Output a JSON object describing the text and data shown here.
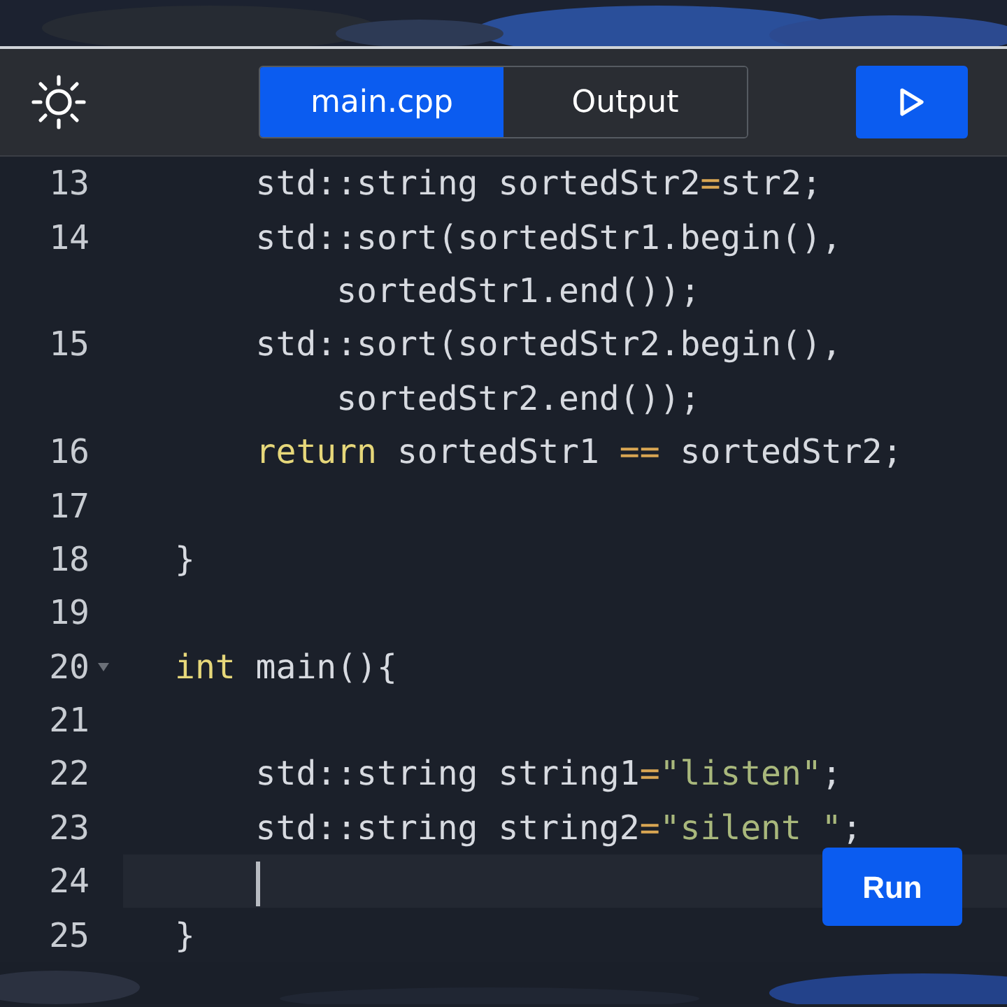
{
  "toolbar": {
    "tabs": [
      {
        "label": "main.cpp",
        "selected": true
      },
      {
        "label": "Output",
        "selected": false
      }
    ]
  },
  "editor": {
    "lines": [
      {
        "number": "13",
        "active": false,
        "foldable": false,
        "rows": [
          [
            {
              "kind": "plain",
              "text": "    std::string sortedStr2"
            },
            {
              "kind": "op",
              "text": "="
            },
            {
              "kind": "plain",
              "text": "str2;"
            }
          ]
        ]
      },
      {
        "number": "14",
        "active": false,
        "foldable": false,
        "rows": [
          [
            {
              "kind": "plain",
              "text": "    std::sort(sortedStr1.begin(),"
            }
          ],
          [
            {
              "kind": "plain",
              "text": "        sortedStr1.end());"
            }
          ]
        ]
      },
      {
        "number": "15",
        "active": false,
        "foldable": false,
        "rows": [
          [
            {
              "kind": "plain",
              "text": "    std::sort(sortedStr2.begin(),"
            }
          ],
          [
            {
              "kind": "plain",
              "text": "        sortedStr2.end());"
            }
          ]
        ]
      },
      {
        "number": "16",
        "active": false,
        "foldable": false,
        "rows": [
          [
            {
              "kind": "keyword",
              "text": "    return"
            },
            {
              "kind": "plain",
              "text": " sortedStr1 "
            },
            {
              "kind": "op",
              "text": "=="
            },
            {
              "kind": "plain",
              "text": " sortedStr2;"
            }
          ]
        ]
      },
      {
        "number": "17",
        "active": false,
        "foldable": false,
        "rows": [
          []
        ]
      },
      {
        "number": "18",
        "active": false,
        "foldable": false,
        "rows": [
          [
            {
              "kind": "plain",
              "text": "}"
            }
          ]
        ]
      },
      {
        "number": "19",
        "active": false,
        "foldable": false,
        "rows": [
          []
        ]
      },
      {
        "number": "20",
        "active": false,
        "foldable": true,
        "rows": [
          [
            {
              "kind": "keyword",
              "text": "int"
            },
            {
              "kind": "plain",
              "text": " main(){"
            }
          ]
        ]
      },
      {
        "number": "21",
        "active": false,
        "foldable": false,
        "rows": [
          []
        ]
      },
      {
        "number": "22",
        "active": false,
        "foldable": false,
        "rows": [
          [
            {
              "kind": "plain",
              "text": "    std::string string1"
            },
            {
              "kind": "op",
              "text": "="
            },
            {
              "kind": "string",
              "text": "\"listen\""
            },
            {
              "kind": "plain",
              "text": ";"
            }
          ]
        ]
      },
      {
        "number": "23",
        "active": false,
        "foldable": false,
        "rows": [
          [
            {
              "kind": "plain",
              "text": "    std::string string2"
            },
            {
              "kind": "op",
              "text": "="
            },
            {
              "kind": "string",
              "text": "\"silent \""
            },
            {
              "kind": "plain",
              "text": ";"
            }
          ]
        ]
      },
      {
        "number": "24",
        "active": true,
        "foldable": false,
        "rows": [
          []
        ]
      },
      {
        "number": "25",
        "active": false,
        "foldable": false,
        "rows": [
          [
            {
              "kind": "plain",
              "text": "}"
            }
          ]
        ]
      }
    ]
  },
  "run_button": {
    "label": "Run"
  }
}
